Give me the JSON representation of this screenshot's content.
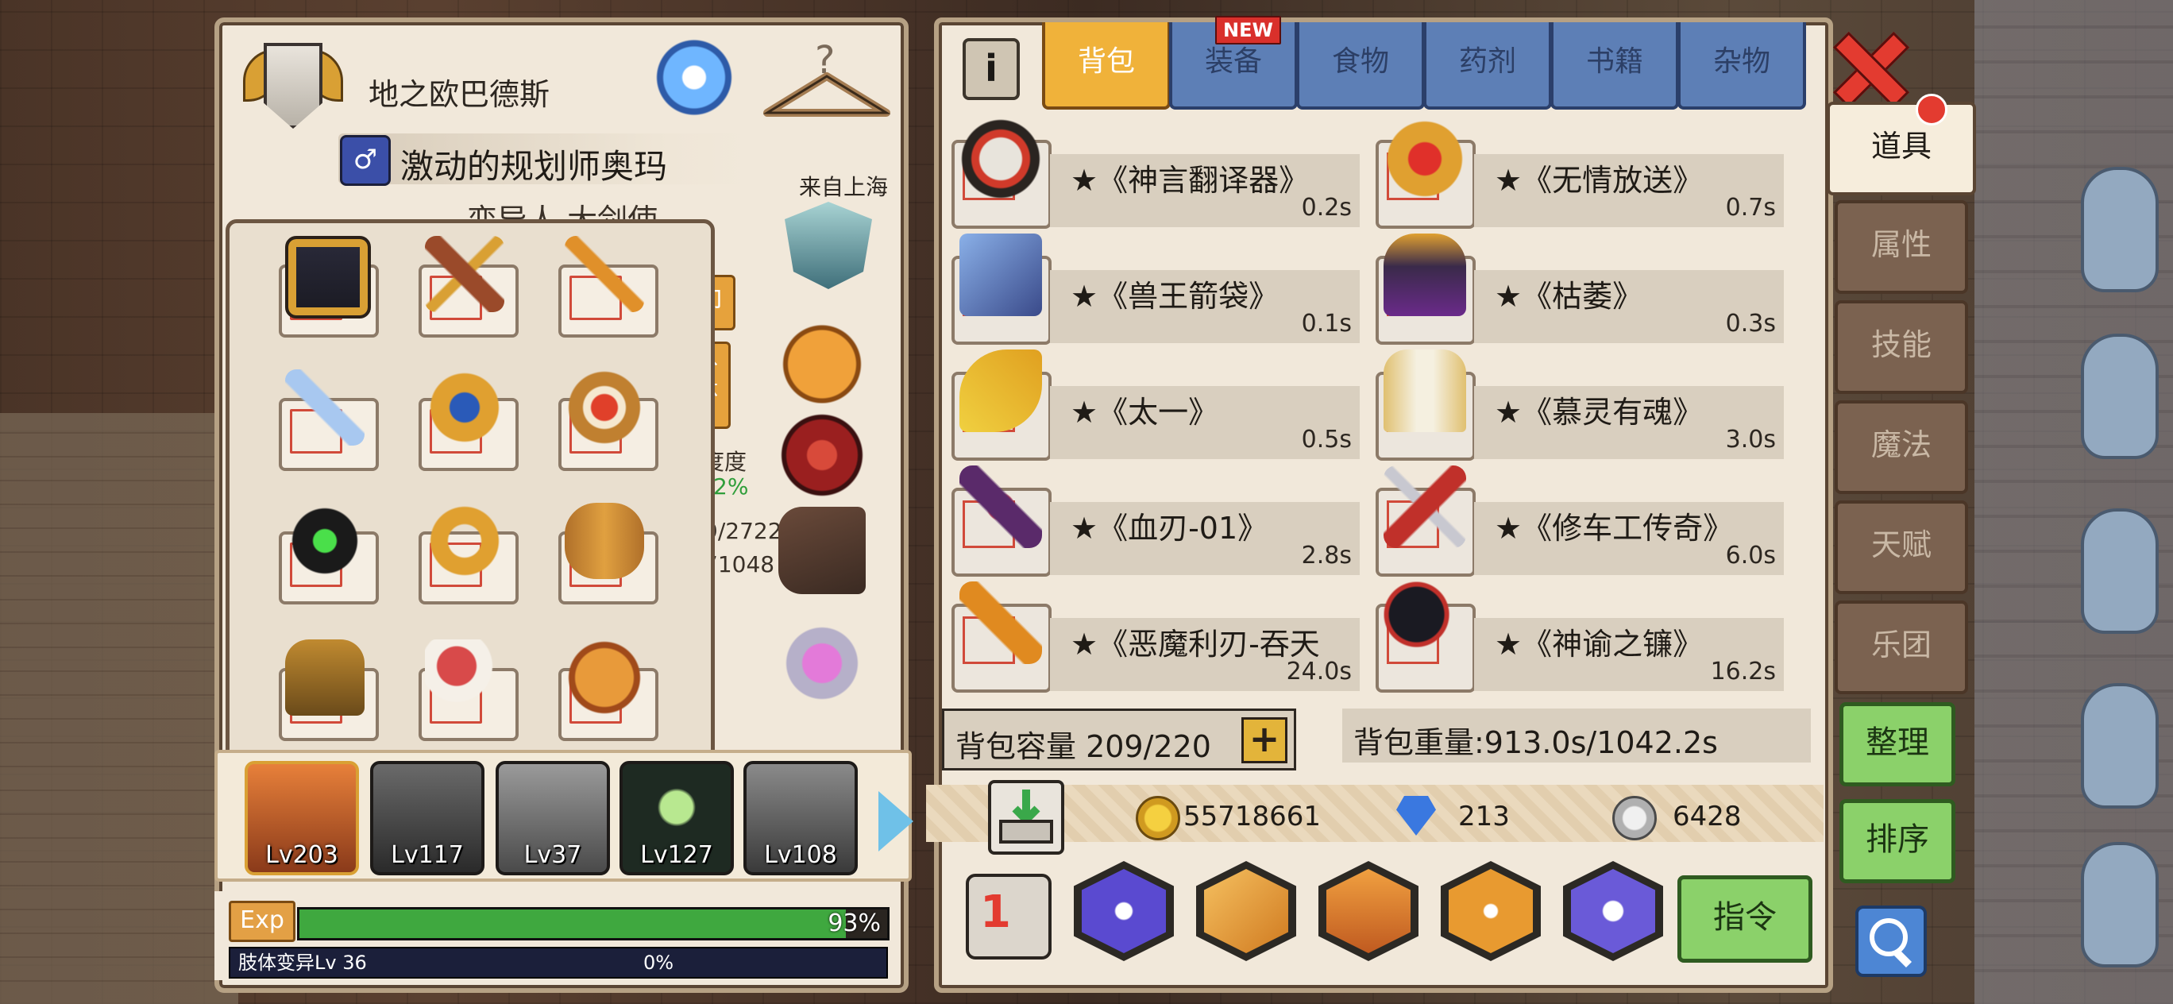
{
  "player": {
    "title": "地之欧巴德斯",
    "gender_symbol": "♂",
    "character_name": "激动的规划师奥玛",
    "origin": "来自上海",
    "subtitle_partial": "变异人 大剑使"
  },
  "side_stats": {
    "btn1": "卸",
    "btn2": "外体",
    "label_partial": "度度",
    "pct_partial": "2%",
    "hp_partial": "9/2722",
    "val_partial": "71048"
  },
  "party": [
    {
      "level": "Lv203"
    },
    {
      "level": "Lv117"
    },
    {
      "level": "Lv37"
    },
    {
      "level": "Lv127"
    },
    {
      "level": "Lv108"
    }
  ],
  "exp": {
    "label": "Exp",
    "percent": "93%",
    "fill": 93
  },
  "mutation": {
    "label": "肢体变异Lv 36",
    "percent": "0%"
  },
  "tabs": [
    {
      "label": "背包",
      "active": true
    },
    {
      "label": "装备",
      "active": false
    },
    {
      "label": "食物",
      "active": false
    },
    {
      "label": "药剂",
      "active": false
    },
    {
      "label": "书籍",
      "active": false
    },
    {
      "label": "杂物",
      "active": false
    }
  ],
  "new_badge": "NEW",
  "info_icon": "i",
  "items": [
    {
      "name": "★《神言翻译器》",
      "weight": "0.2s"
    },
    {
      "name": "★《无情放送》",
      "weight": "0.7s"
    },
    {
      "name": "★《兽王箭袋》",
      "weight": "0.1s"
    },
    {
      "name": "★《枯萎》",
      "weight": "0.3s"
    },
    {
      "name": "★《太一》",
      "weight": "0.5s"
    },
    {
      "name": "★《慕灵有魂》",
      "weight": "3.0s"
    },
    {
      "name": "★《血刃-01》",
      "weight": "2.8s"
    },
    {
      "name": "★《修车工传奇》",
      "weight": "6.0s"
    },
    {
      "name": "★《恶魔利刃-吞天",
      "weight": "24.0s"
    },
    {
      "name": "★《神谕之镰》",
      "weight": "16.2s"
    }
  ],
  "bag": {
    "capacity": "背包容量 209/220",
    "weight": "背包重量:913.0s/1042.2s",
    "plus": "+"
  },
  "currency": {
    "gold": "55718661",
    "gems": "213",
    "silver": "6428"
  },
  "slot_number": "1",
  "command_label": "指令",
  "side_menu": [
    {
      "label": "道具",
      "active": true
    },
    {
      "label": "属性",
      "active": false
    },
    {
      "label": "技能",
      "active": false
    },
    {
      "label": "魔法",
      "active": false
    },
    {
      "label": "天赋",
      "active": false
    },
    {
      "label": "乐团",
      "active": false
    }
  ],
  "buttons": {
    "organize": "整理",
    "sort": "排序"
  },
  "colors": {
    "panel": "#f1e8da",
    "tab_active": "#f0b23a",
    "tab_inactive": "#5d7fb6",
    "exp_fill": "#3fa83f",
    "close": "#e33b30",
    "green_button": "#8bd16a"
  }
}
